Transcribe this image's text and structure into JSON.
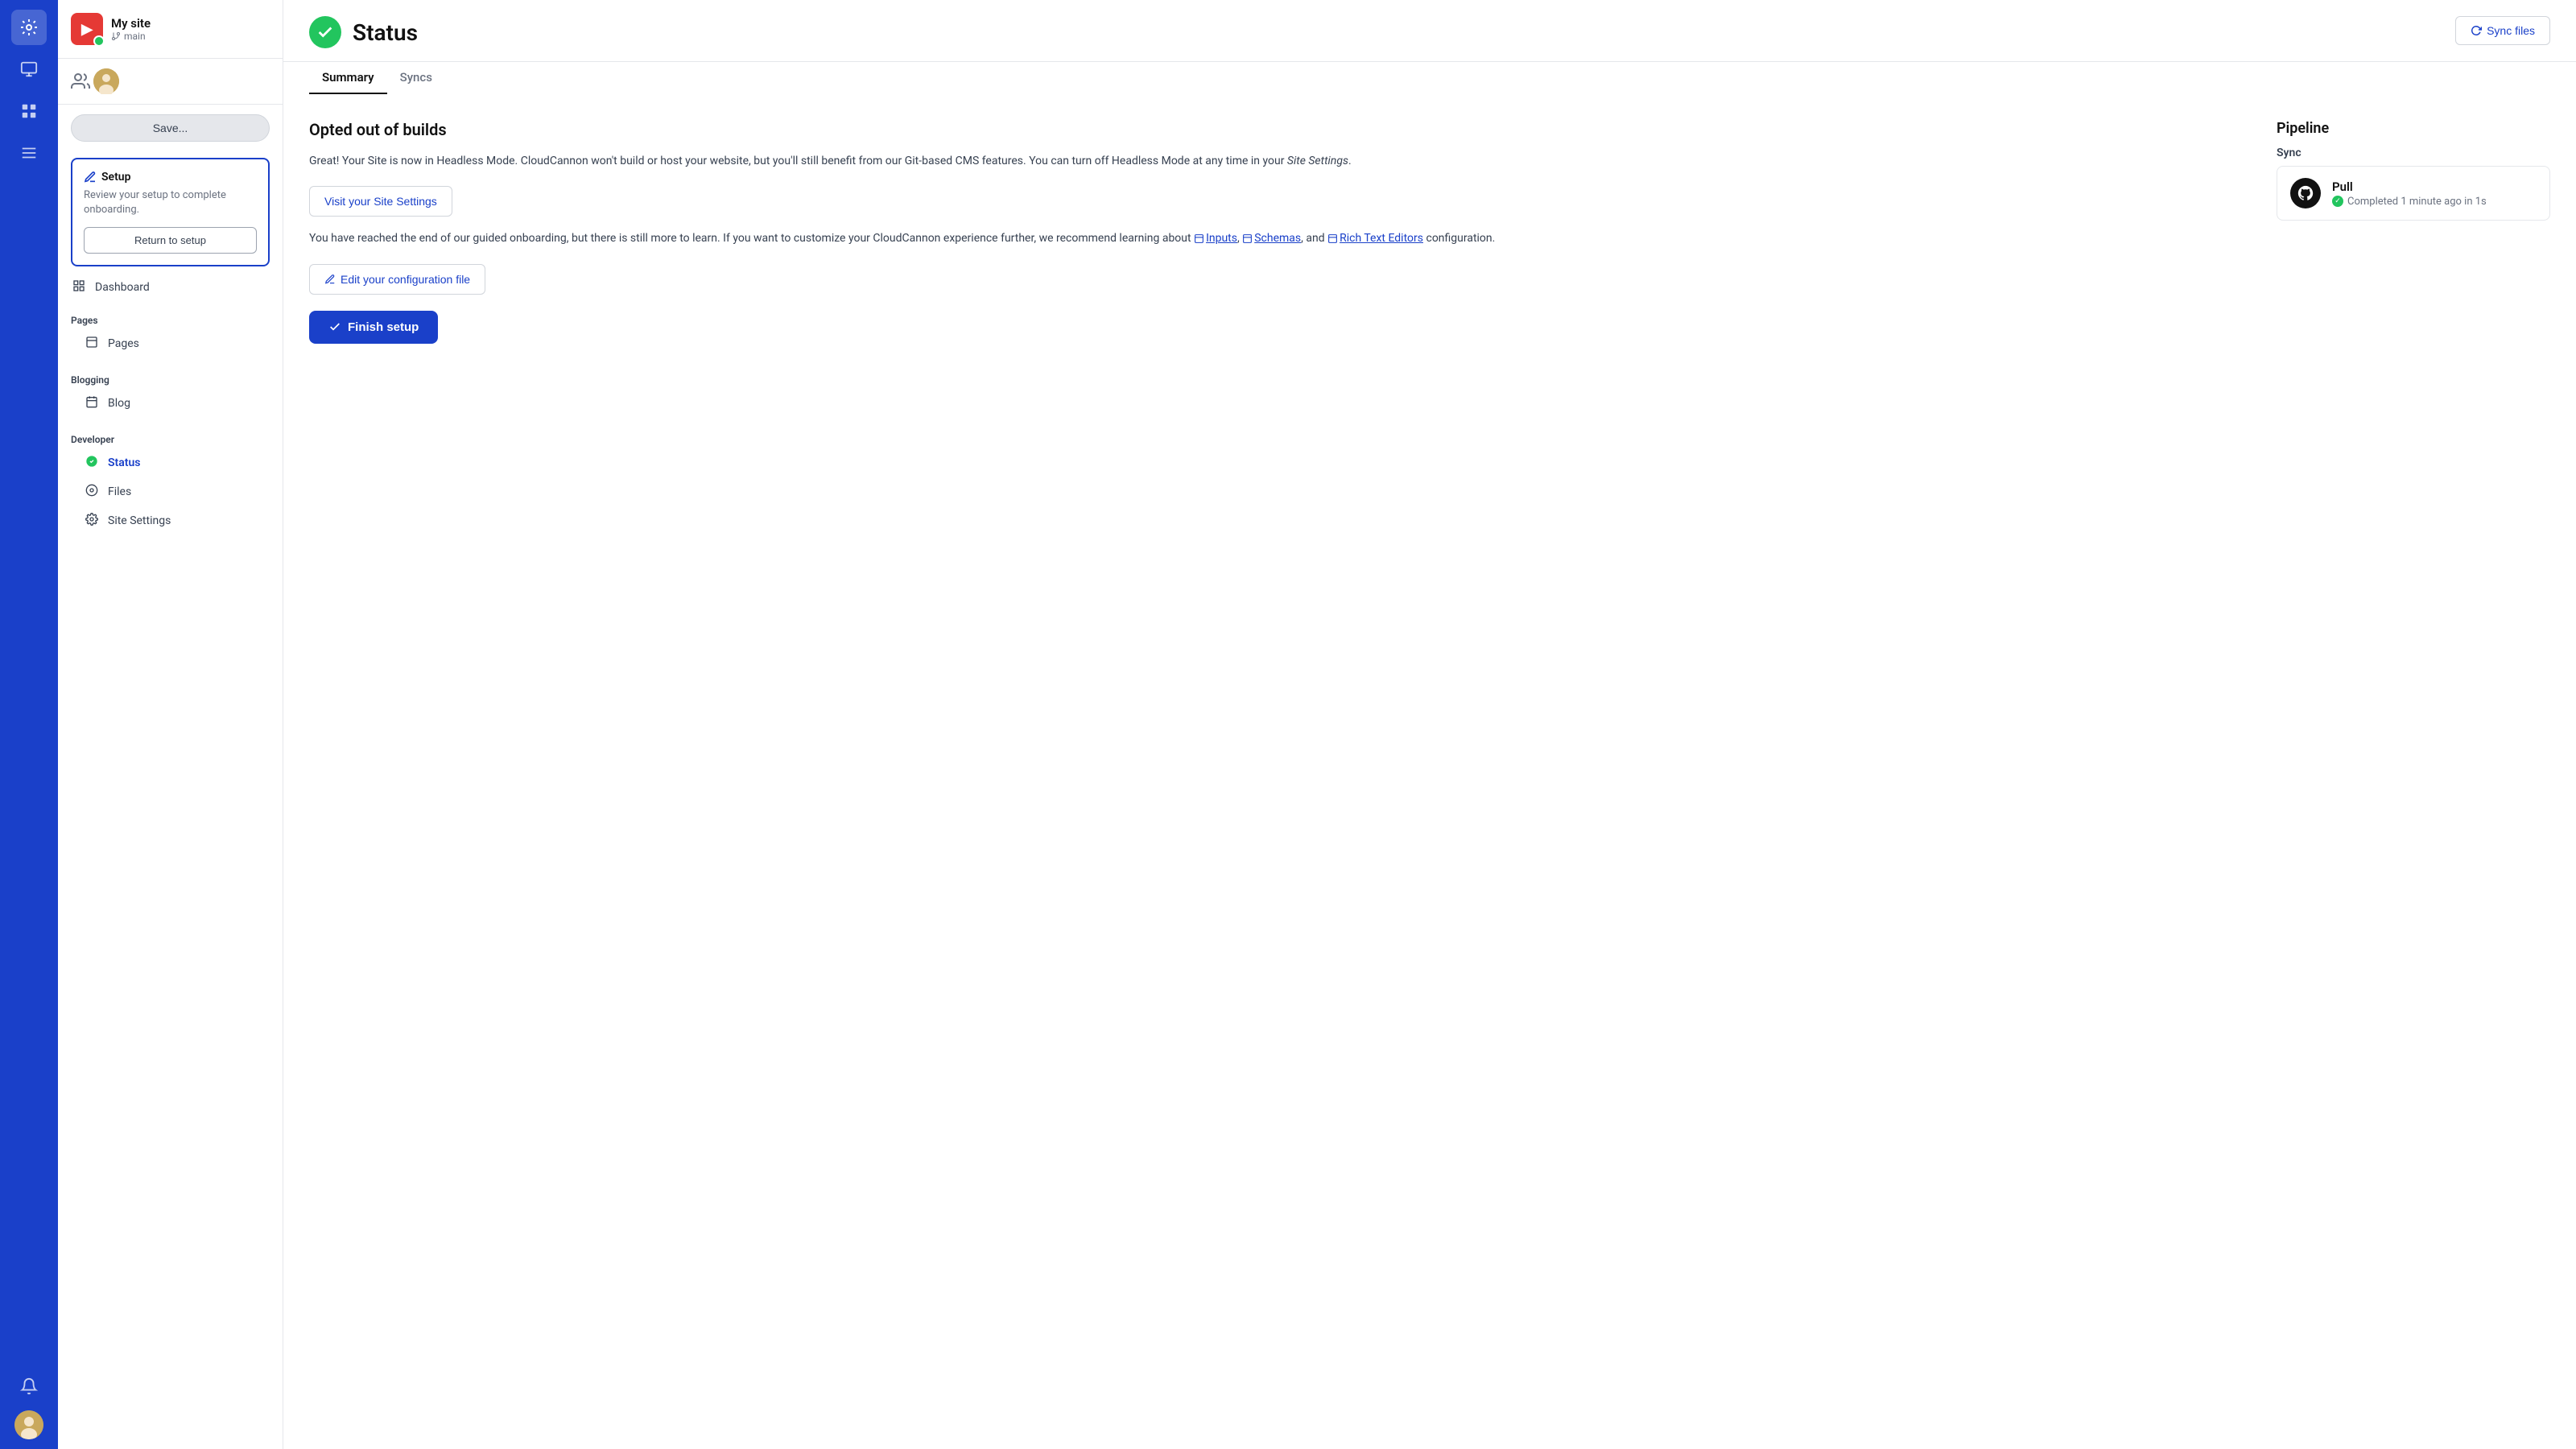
{
  "rail": {
    "icons": [
      {
        "name": "cloud-icon",
        "symbol": "☁",
        "active": true
      },
      {
        "name": "monitor-icon",
        "symbol": "⬜"
      },
      {
        "name": "grid-icon",
        "symbol": "⊞",
        "active": false
      },
      {
        "name": "list-icon",
        "symbol": "≡"
      }
    ]
  },
  "sidebar": {
    "site_name": "My site",
    "branch": "main",
    "save_label": "Save...",
    "setup": {
      "title": "Setup",
      "description": "Review your setup to complete onboarding.",
      "return_btn_label": "Return to setup"
    },
    "nav": {
      "dashboard_label": "Dashboard",
      "pages_section": "Pages",
      "pages_label": "Pages",
      "blogging_section": "Blogging",
      "blog_label": "Blog",
      "developer_section": "Developer",
      "status_label": "Status",
      "files_label": "Files",
      "site_settings_label": "Site Settings"
    }
  },
  "header": {
    "title": "Status",
    "sync_files_label": "Sync files",
    "tabs": [
      {
        "label": "Summary",
        "active": true
      },
      {
        "label": "Syncs",
        "active": false
      }
    ]
  },
  "main": {
    "section_heading": "Opted out of builds",
    "description_1a": "Great! Your Site is now in Headless Mode. CloudCannon won't build or host your website, but you'll still benefit from our Git-based CMS features. You can turn off Headless Mode at any time in your ",
    "description_1b": "Site Settings",
    "description_1c": ".",
    "visit_settings_label": "Visit your Site Settings",
    "description_2_prefix": "You have reached the end of our guided onboarding, but there is still more to learn. If you want to customize your CloudCannon experience further, we recommend learning about ",
    "inputs_link": "Inputs",
    "schemas_link": "Schemas",
    "rte_link": "Rich Text Editors",
    "description_2_suffix": " configuration.",
    "edit_config_label": "Edit your configuration file",
    "finish_setup_label": "Finish setup"
  },
  "pipeline": {
    "title": "Pipeline",
    "sync_label": "Sync",
    "pull_name": "Pull",
    "pull_status": "Completed 1 minute ago in 1s"
  }
}
